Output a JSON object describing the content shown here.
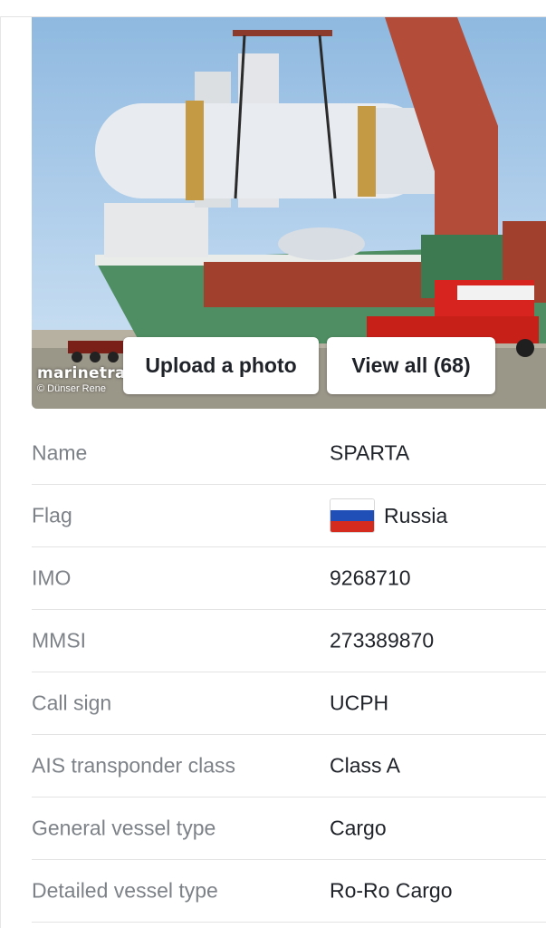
{
  "photo": {
    "watermark_logo": "marinetraffic",
    "credit": "© Dünser Rene"
  },
  "buttons": {
    "upload": "Upload a photo",
    "view_all": "View all (68)"
  },
  "details": [
    {
      "label": "Name",
      "value": "SPARTA"
    },
    {
      "label": "Flag",
      "value": "Russia"
    },
    {
      "label": "IMO",
      "value": "9268710"
    },
    {
      "label": "MMSI",
      "value": "273389870"
    },
    {
      "label": "Call sign",
      "value": "UCPH"
    },
    {
      "label": "AIS transponder class",
      "value": "Class A"
    },
    {
      "label": "General vessel type",
      "value": "Cargo"
    },
    {
      "label": "Detailed vessel type",
      "value": "Ro-Ro Cargo"
    }
  ],
  "flag_colors": {
    "white": "#ffffff",
    "blue": "#1f4fb7",
    "red": "#d52b1e"
  }
}
